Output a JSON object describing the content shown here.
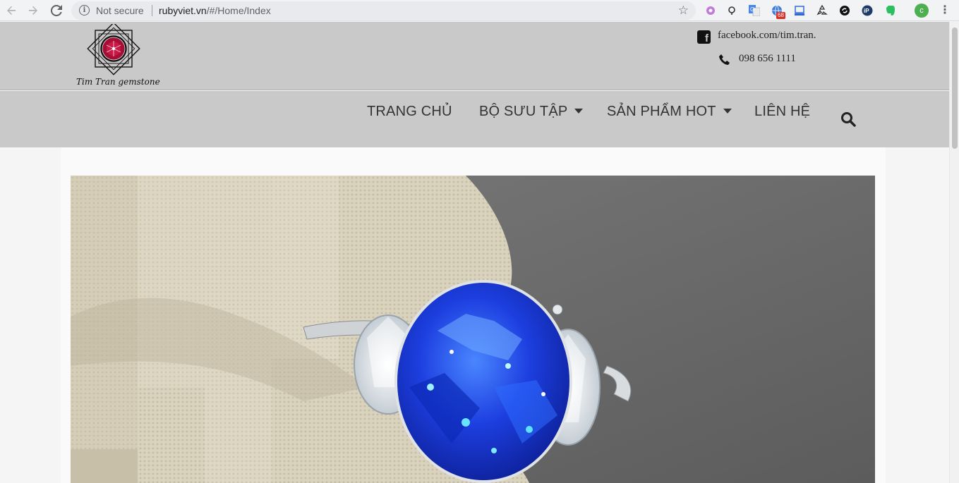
{
  "browser": {
    "security_label": "Not secure",
    "url_host": "rubyviet.vn",
    "url_path": "/#/Home/Index",
    "extension_badge": "68",
    "profile_initial": "c"
  },
  "header": {
    "brand": "Tim Tran gemstone",
    "facebook": "facebook.com/tim.tran.",
    "phone": "098 656 1111"
  },
  "nav": {
    "items": [
      {
        "label": "TRANG CHỦ"
      },
      {
        "label": "BỘ SƯU TẬP"
      },
      {
        "label": "SẢN PHẨM HOT"
      },
      {
        "label": "LIÊN HỆ"
      }
    ]
  },
  "colors": {
    "header_bg": "#c9c9c9",
    "sapphire": "#1d3fe0",
    "ruby": "#b5123c"
  }
}
